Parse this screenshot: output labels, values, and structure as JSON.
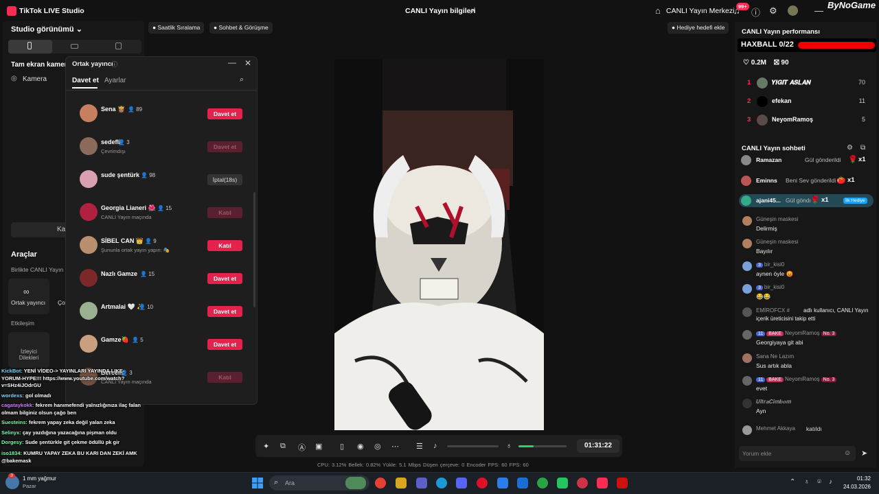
{
  "titlebar": {
    "app_name": "TikTok LIVE Studio",
    "center_title": "CANLI Yayın bilgileri",
    "live_center": "CANLI Yayın Merkezi",
    "notif_badge": "99+",
    "brand": "ByNoGame"
  },
  "left_panel": {
    "studio_view": "Studio görünümü",
    "source_title": "Tam ekran kamera",
    "camera": "Kamera",
    "ka_button": "Ka",
    "tools_title": "Araçlar",
    "together_live": "Birlikte CANLI Yayın",
    "cohost_tool": "Ortak yayıncı",
    "second_tool": "Ço",
    "interaction": "Etkileşim",
    "viewer_tool": "İzleyici Dilekleri"
  },
  "top_chips": {
    "hourly_ranking": "Saatlik Sıralama",
    "chat_meet": "Sohbet & Görüşme",
    "gift_goal": "Hediye hedefi ekle"
  },
  "popup": {
    "title": "Ortak yayıncı",
    "tab_invite": "Davet et",
    "tab_settings": "Ayarlar",
    "rows": [
      {
        "name": "Sena 👸🏽",
        "count": "89",
        "sub": "",
        "button": "Davet et",
        "state": "red",
        "color": "#c68060"
      },
      {
        "name": "sedefli",
        "count": "3",
        "sub": "Çevrimdışı",
        "button": "Davet et",
        "state": "dim",
        "color": "#8a6a5a"
      },
      {
        "name": "sude şentürk",
        "count": "98",
        "sub": "",
        "button": "İptal(18s)",
        "state": "gray",
        "color": "#d8a0b0"
      },
      {
        "name": "Georgia Lianeri 🌺",
        "count": "15",
        "sub": "CANLI Yayın maçında",
        "button": "Katıl",
        "state": "dim",
        "color": "#b02040"
      },
      {
        "name": "SİBEL CAN 👑",
        "count": "9",
        "sub": "Şununla ortak yayın yapın: 🎭",
        "button": "Katıl",
        "state": "red",
        "color": "#b89070"
      },
      {
        "name": "Nazlı Gamze",
        "count": "15",
        "sub": "",
        "button": "Davet et",
        "state": "red",
        "color": "#7a2828"
      },
      {
        "name": "Artmalai 🤍 ✨",
        "count": "10",
        "sub": "",
        "button": "Davet et",
        "state": "red",
        "color": "#9ab090"
      },
      {
        "name": "Gamze🍓",
        "count": "5",
        "sub": "",
        "button": "Davet et",
        "state": "red",
        "color": "#c8a080"
      },
      {
        "name": "Bercem",
        "count": "3",
        "sub": "CANLI Yayın maçında",
        "button": "Katıl",
        "state": "dim",
        "color": "#705040"
      }
    ]
  },
  "controls": {
    "timer": "01:31:22",
    "stats": "CPU: 3.12%   Bellek: 0.82%   Yükle: 5.1 Mbps   Düşen çerçeve: 0   Encoder FPS: 60   FPS: 60",
    "mic_level": 0.31
  },
  "right_panel": {
    "performance_title": "CANLI Yayın performansı",
    "haxball": "HAXBALL 0/22",
    "likes": "0.2M",
    "gifts": "90",
    "ranking": [
      {
        "rank": "1",
        "name": "𝒀𝑰𝑮𝑰𝑻 𝑨𝑺𝑳𝑨𝑵",
        "value": "70",
        "color": "#667766"
      },
      {
        "rank": "2",
        "name": "efekan",
        "value": "11",
        "color": "#000000"
      },
      {
        "rank": "3",
        "name": "NeyomRamoş",
        "value": "5",
        "color": "#5a4a4a"
      }
    ],
    "chat_title": "CANLI Yayın sohbeti",
    "gifts_feed": [
      {
        "user": "Ramazan",
        "action": "Gül gönderildi",
        "multiplier": "x1",
        "icon": "🌹",
        "badge": ""
      },
      {
        "user": "Eminns",
        "action": "Beni Sev gönderildi",
        "multiplier": "x1",
        "icon": "🍅",
        "badge": ""
      },
      {
        "user": "ajani45...",
        "action": "Gül göndı",
        "multiplier": "x1",
        "icon": "🌹",
        "badge": "İlk Hediye"
      }
    ],
    "messages": [
      {
        "user": "Güneşin maskesi",
        "text": "Delirmiş",
        "level": "",
        "fan": "",
        "rank": ""
      },
      {
        "user": "Güneşin maskesi",
        "text": "Bayılır",
        "level": "",
        "fan": "",
        "rank": ""
      },
      {
        "user": "bir_kisi0",
        "text": "aynen öyle 😡",
        "level": "3",
        "fan": "",
        "rank": ""
      },
      {
        "user": "bir_kisi0",
        "text": "😂😂",
        "level": "3",
        "fan": "",
        "rank": ""
      },
      {
        "user": "EMİROFCX #",
        "text": "adlı kullanıcı, CANLI Yayın",
        "text2": "içerik üreticisini takip etti",
        "level": "",
        "fan": "",
        "rank": ""
      },
      {
        "user": "NeyomRamoş",
        "text": "Georgiyaya git abi",
        "level": "11",
        "fan": "BAKE",
        "rank": "No. 3"
      },
      {
        "user": "Sana Ne Lazım",
        "text": "Sus artık abla",
        "level": "",
        "fan": "",
        "rank": ""
      },
      {
        "user": "NeyomRamoş",
        "text": "evet",
        "level": "11",
        "fan": "BAKE",
        "rank": "No. 3"
      },
      {
        "user": "𝑼𝒍𝒕𝒓𝒂𝑪𝒊𝒎𝒃𝒐𝒎",
        "text": "Ayn",
        "level": "",
        "fan": "",
        "rank": ""
      },
      {
        "user": "Mehmet Akkaya",
        "text": "katıldı",
        "level": "",
        "fan": "",
        "rank": ""
      }
    ],
    "comment_placeholder": "Yorum ekle"
  },
  "overlay_chat": [
    {
      "user": "KickBot:",
      "text": "YENİ VİDEO-> YAYINLARI YAYINDA LIKE-"
    },
    {
      "user": "",
      "text": "YORUM-HYPE!!! https://www.youtube.com/watch?"
    },
    {
      "user": "",
      "text": "v=SHz4iJOdrGU"
    },
    {
      "user": "wordexs:",
      "text": "gol olmadı"
    },
    {
      "user": "cagataykokk:",
      "text": "fekrem hanımefendi yalnızlığınıza ilaç falan"
    },
    {
      "user": "",
      "text": "olmam bilginiz olsun çağo ben"
    },
    {
      "user": "Suesteins:",
      "text": "fekrem yapay zeka değil yalan zeka"
    },
    {
      "user": "Selinyx:",
      "text": "çay yazdığına yazacağına pişman oldu"
    },
    {
      "user": "Dorgesy:",
      "text": "Sude şentürkle git çekme ödüllü pk gir"
    },
    {
      "user": "iso1834:",
      "text": "KUMRU YAPAY ZEKA BU KARI DAN ZEKİ AMK"
    },
    {
      "user": "",
      "text": "@bakemask"
    }
  ],
  "taskbar": {
    "weather": "1 mm yağmur",
    "weather_day": "Pazar",
    "temp_badge": "3",
    "search": "Ara",
    "time": "01:32",
    "date": "24.03.2026"
  }
}
